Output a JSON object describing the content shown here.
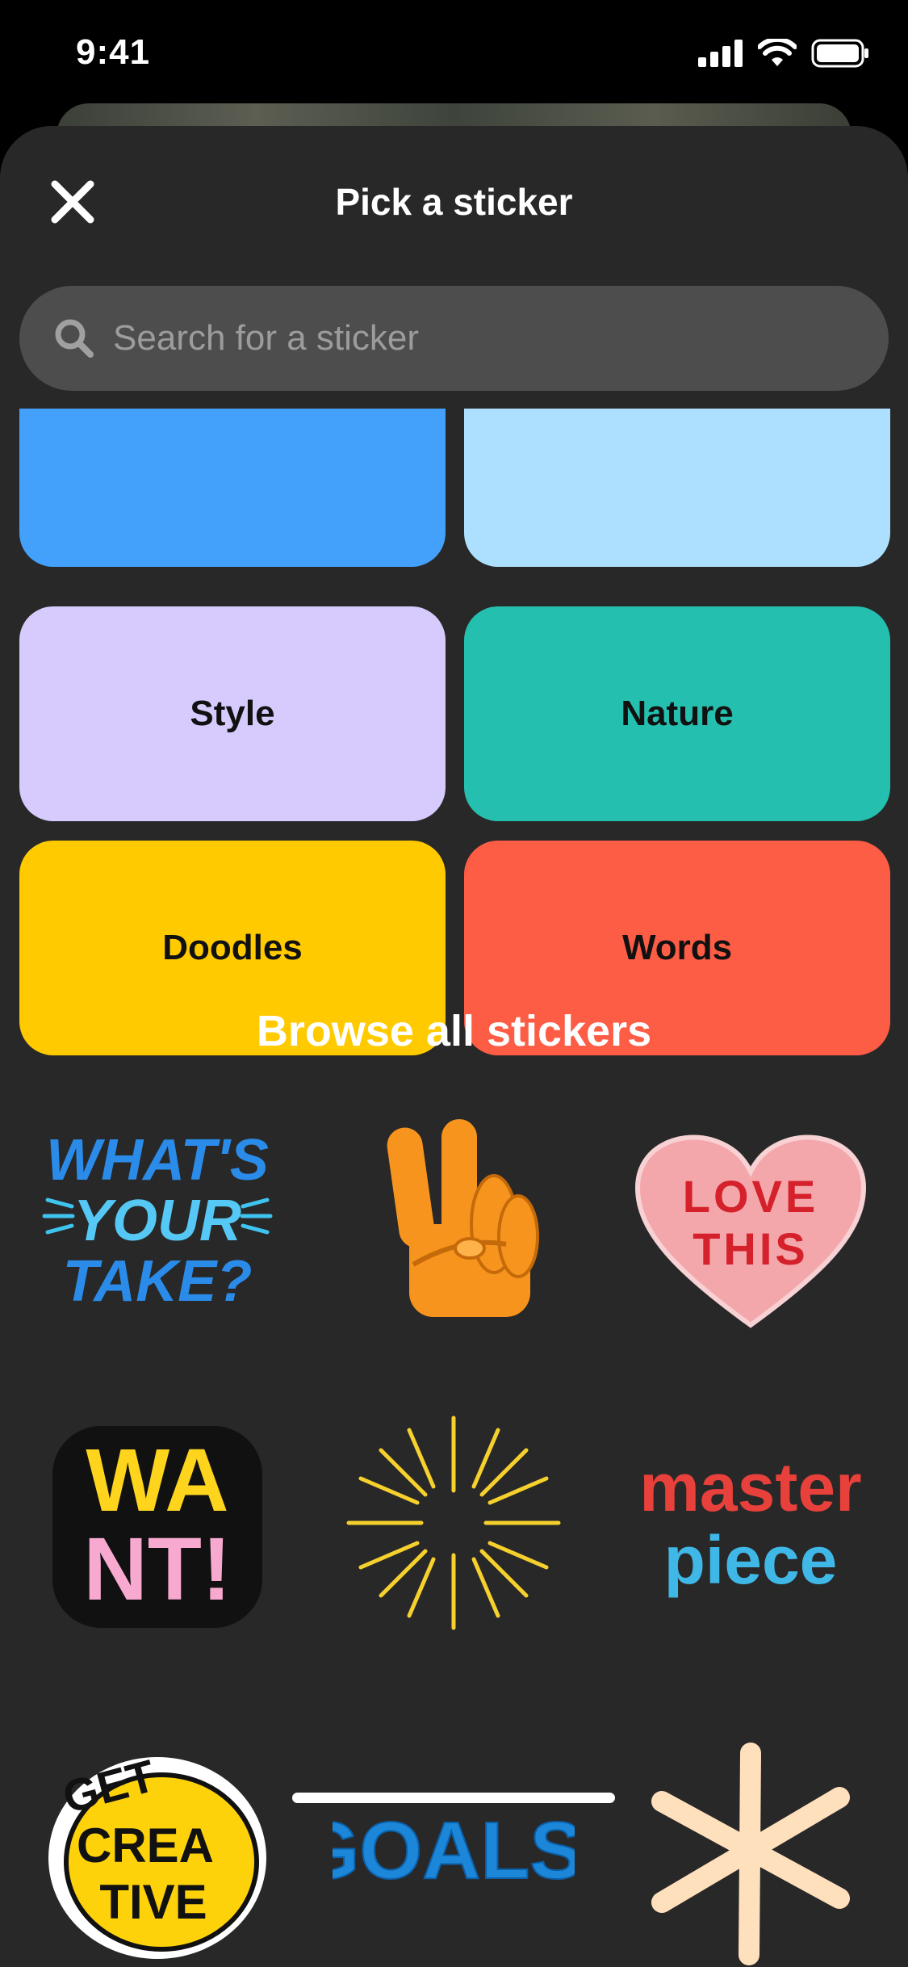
{
  "status": {
    "time": "9:41"
  },
  "sheet": {
    "title": "Pick a sticker"
  },
  "search": {
    "placeholder": "Search for a sticker"
  },
  "categories": [
    {
      "label": "",
      "color": "#44a1fb"
    },
    {
      "label": "",
      "color": "#ade0fe"
    },
    {
      "label": "Style",
      "color": "#d7cbfd"
    },
    {
      "label": "Nature",
      "color": "#24bfae"
    },
    {
      "label": "Doodles",
      "color": "#ffca00"
    },
    {
      "label": "Words",
      "color": "#fd5c45"
    }
  ],
  "browse": {
    "title": "Browse all stickers",
    "stickers": [
      {
        "name": "whats-your-take",
        "text": [
          "WHAT'S",
          "YOUR",
          "TAKE?"
        ]
      },
      {
        "name": "peace-hand"
      },
      {
        "name": "love-this-heart",
        "text": [
          "LOVE",
          "THIS"
        ]
      },
      {
        "name": "want",
        "text": [
          "WA",
          "NT!"
        ]
      },
      {
        "name": "sparkle-burst"
      },
      {
        "name": "masterpiece",
        "text": [
          "master",
          "piece"
        ]
      },
      {
        "name": "get-creative",
        "text": [
          "GET",
          "CREA",
          "TIVE"
        ]
      },
      {
        "name": "goals",
        "text": [
          "GOALS!"
        ]
      },
      {
        "name": "asterisk-doodle"
      }
    ]
  }
}
